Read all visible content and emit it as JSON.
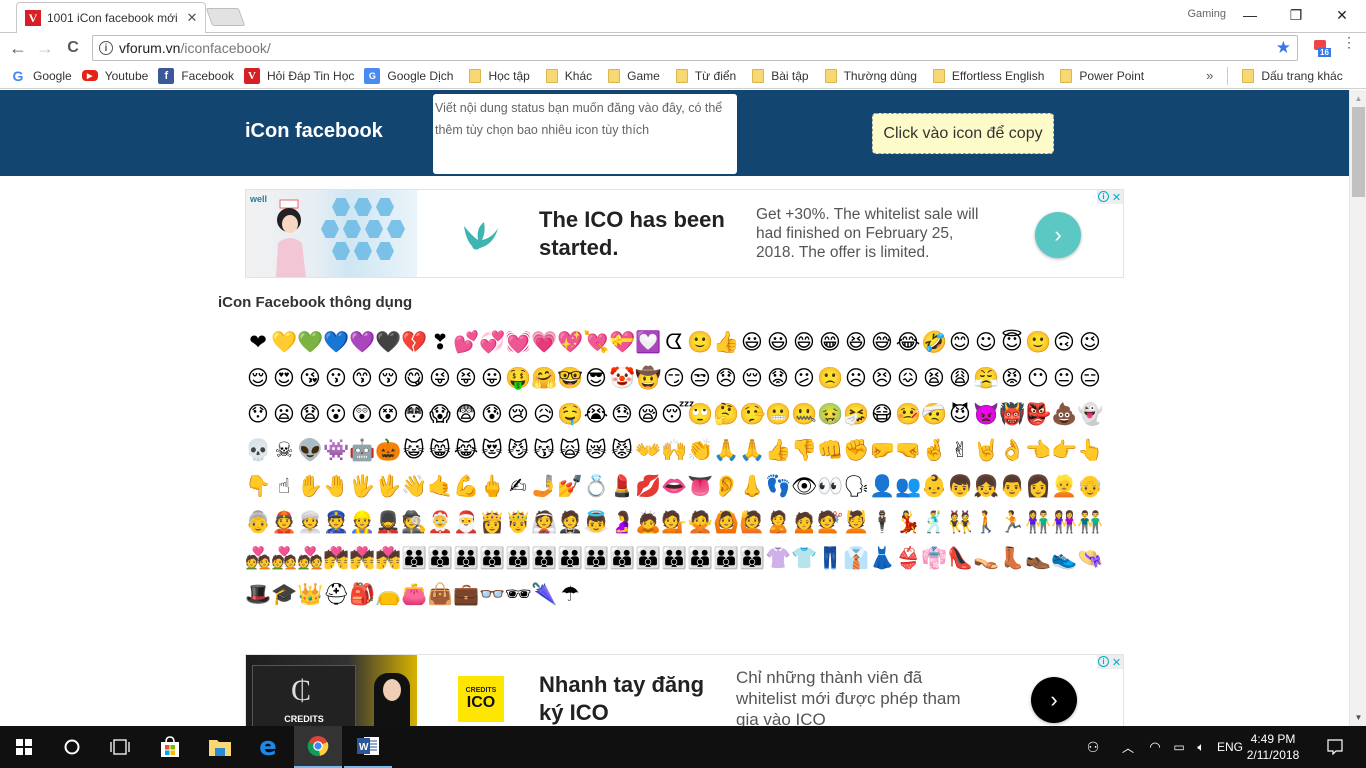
{
  "browser": {
    "tab_title": "1001 iCon facebook mới",
    "tab_close": "✕",
    "profile_name": "Gaming",
    "window_buttons": {
      "minimize": "—",
      "maximize": "❐",
      "close": "✕"
    },
    "nav": {
      "back": "←",
      "forward": "→",
      "reload": "C"
    },
    "url_host": "vforum.vn",
    "url_path": "/iconfacebook/",
    "bookmark_star": "★",
    "extension_badge": "16",
    "menu_icon": "⋮",
    "bookmarks": [
      {
        "label": "Google",
        "icon": "google-icon"
      },
      {
        "label": "Youtube",
        "icon": "youtube-icon"
      },
      {
        "label": "Facebook",
        "icon": "facebook-icon"
      },
      {
        "label": "Hỏi Đáp Tin Học",
        "icon": "vforum-icon"
      },
      {
        "label": "Google Dịch",
        "icon": "google-translate-icon"
      },
      {
        "label": "Học tập",
        "icon": "folder-icon"
      },
      {
        "label": "Khác",
        "icon": "folder-icon"
      },
      {
        "label": "Game",
        "icon": "folder-icon"
      },
      {
        "label": "Từ điển",
        "icon": "folder-icon"
      },
      {
        "label": "Bài tập",
        "icon": "folder-icon"
      },
      {
        "label": "Thường dùng",
        "icon": "folder-icon"
      },
      {
        "label": "Effortless English",
        "icon": "folder-icon"
      },
      {
        "label": "Power Point",
        "icon": "folder-icon"
      }
    ],
    "bookmarks_overflow": "»",
    "other_bookmarks": "Dấu trang khác"
  },
  "header": {
    "site_title": "iCon facebook",
    "status_placeholder": "Viết nội dung status bạn muốn đăng vào đây, có thể thêm tùy chọn bao nhiêu icon tùy thích",
    "copy_button": "Click vào icon để copy",
    "background_color": "#124671"
  },
  "ads": [
    {
      "headline": "The ICO has been started.",
      "body": "Get +30%. The whitelist sale will had finished on February 25, 2018. The offer is limited.",
      "image_caption": "well",
      "cta_icon": "›",
      "cta_color": "#5bc8c3",
      "choices_info": "i",
      "choices_close": "✕"
    },
    {
      "headline": "Nhanh tay đăng ký ICO",
      "body": "Chỉ những thành viên đã whitelist mới được phép tham gia vào ICO",
      "image_caption": "CREDITS",
      "logo_top": "CREDITS",
      "logo_bottom": "ICO",
      "cta_icon": "›",
      "cta_color": "#000000",
      "choices_info": "i",
      "choices_close": "✕"
    }
  ],
  "section_title": "iCon Facebook thông dụng",
  "emojis": [
    "❤",
    "💛",
    "💚",
    "💙",
    "💜",
    "🖤",
    "💔",
    "❣",
    "💕",
    "💞",
    "💓",
    "💗",
    "💖",
    "💘",
    "💝",
    "💟",
    "ᗧ",
    "🙂",
    "👍",
    "😃",
    "😃",
    "😄",
    "😁",
    "😆",
    "😅",
    "😂",
    "🤣",
    "😊",
    "☺",
    "😇",
    "🙂",
    "🙃",
    "😉",
    "😌",
    "😍",
    "😘",
    "😗",
    "😙",
    "😚",
    "😋",
    "😜",
    "😝",
    "😛",
    "🤑",
    "🤗",
    "🤓",
    "😎",
    "🤡",
    "🤠",
    "😏",
    "😒",
    "😞",
    "😔",
    "😟",
    "😕",
    "🙁",
    "☹",
    "😣",
    "😖",
    "😫",
    "😩",
    "😤",
    "😡",
    "😶",
    "😐",
    "😑",
    "😯",
    "😦",
    "😧",
    "😮",
    "😲",
    "😵",
    "😳",
    "😱",
    "😨",
    "😰",
    "😢",
    "😥",
    "🤤",
    "😭",
    "😓",
    "😪",
    "😴",
    "🙄",
    "🤔",
    "🤥",
    "😬",
    "🤐",
    "🤢",
    "🤧",
    "😷",
    "🤒",
    "🤕",
    "😈",
    "👿",
    "👹",
    "👺",
    "💩",
    "👻",
    "💀",
    "☠",
    "👽",
    "👾",
    "🤖",
    "🎃",
    "😺",
    "😸",
    "😹",
    "😻",
    "😼",
    "😽",
    "🙀",
    "😿",
    "😾",
    "👐",
    "🙌",
    "👏",
    "🙏",
    "🙏",
    "👍",
    "👎",
    "👊",
    "✊",
    "🤛",
    "🤜",
    "🤞",
    "✌",
    "🤘",
    "👌",
    "👈",
    "👉",
    "👆",
    "👇",
    "☝",
    "✋",
    "🤚",
    "🖐",
    "🖖",
    "👋",
    "🤙",
    "💪",
    "🖕",
    "✍",
    "🤳",
    "💅",
    "💍",
    "💄",
    "💋",
    "👄",
    "👅",
    "👂",
    "👃",
    "👣",
    "👁",
    "👀",
    "🗣",
    "👤",
    "👥",
    "👶",
    "👦",
    "👧",
    "👨",
    "👩",
    "👱",
    "👴",
    "👵",
    "👲",
    "👳",
    "👮",
    "👷",
    "💂",
    "🕵",
    "🤶",
    "🎅",
    "👸",
    "🤴",
    "👰",
    "🤵",
    "👼",
    "🤰",
    "🙇",
    "💁",
    "🙅",
    "🙆",
    "🙋",
    "🙎",
    "🙍",
    "💇",
    "💆",
    "🕴",
    "💃",
    "🕺",
    "👯",
    "🚶",
    "🏃",
    "👫",
    "👭",
    "👬",
    "💑",
    "💑",
    "💑",
    "💏",
    "💏",
    "💏",
    "👪",
    "👪",
    "👪",
    "👪",
    "👪",
    "👪",
    "👪",
    "👪",
    "👪",
    "👪",
    "👪",
    "👪",
    "👪",
    "👪",
    "👚",
    "👕",
    "👖",
    "👔",
    "👗",
    "👙",
    "👘",
    "👠",
    "👡",
    "👢",
    "👞",
    "👟",
    "👒",
    "🎩",
    "🎓",
    "👑",
    "⛑",
    "🎒",
    "👝",
    "👛",
    "👜",
    "💼",
    "👓",
    "🕶",
    "🌂",
    "☂"
  ],
  "taskbar": {
    "start_icon": "windows-logo",
    "apps": [
      "cortana",
      "task-view",
      "store",
      "file-explorer",
      "edge",
      "chrome",
      "word"
    ],
    "language": "ENG",
    "time": "4:49 PM",
    "date": "2/11/2018"
  }
}
